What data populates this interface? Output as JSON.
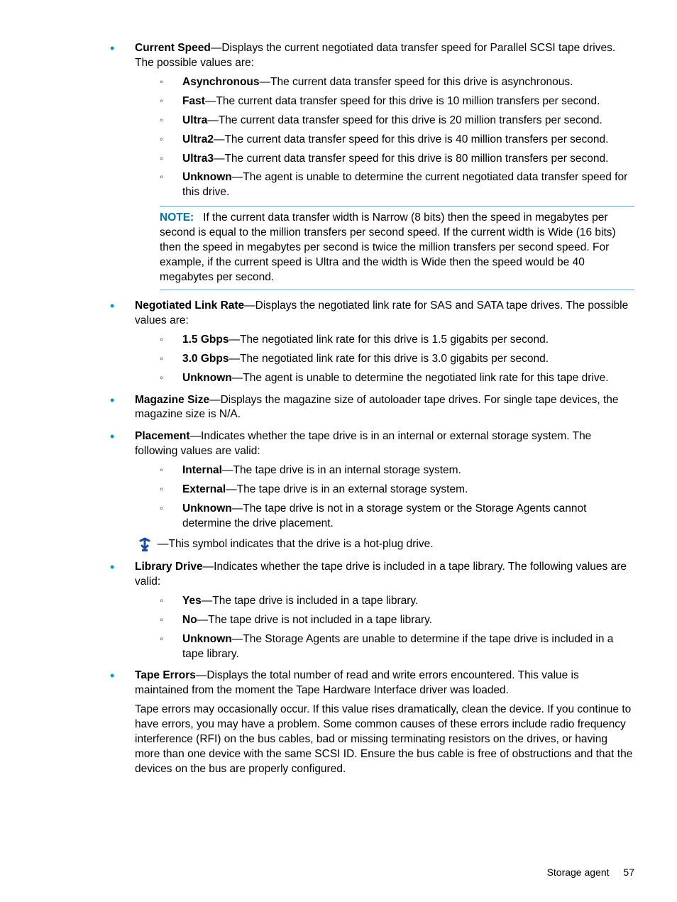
{
  "items": {
    "currentSpeed": {
      "term": "Current Speed",
      "desc": "—Displays the current negotiated data transfer speed for Parallel SCSI tape drives. The possible values are:",
      "sub": [
        {
          "term": "Asynchronous",
          "desc": "—The current data transfer speed for this drive is asynchronous."
        },
        {
          "term": "Fast",
          "desc": "—The current data transfer speed for this drive is 10 million transfers per second."
        },
        {
          "term": "Ultra",
          "desc": "—The current data transfer speed for this drive is 20 million transfers per second."
        },
        {
          "term": "Ultra2",
          "desc": "—The current data transfer speed for this drive is 40 million transfers per second."
        },
        {
          "term": "Ultra3",
          "desc": "—The current data transfer speed for this drive is 80 million transfers per second."
        },
        {
          "term": "Unknown",
          "desc": "—The agent is unable to determine the current negotiated data transfer speed for this drive."
        }
      ],
      "note": {
        "label": "NOTE:",
        "text": "If the current data transfer width is Narrow (8 bits) then the speed in megabytes per second is equal to the million transfers per second speed. If the current width is Wide (16 bits) then the speed in megabytes per second is twice the million transfers per second speed. For example, if the current speed is Ultra and the width is Wide then the speed would be 40 megabytes per second."
      }
    },
    "negLinkRate": {
      "term": "Negotiated Link Rate",
      "desc": "—Displays the negotiated link rate for SAS and SATA tape drives. The possible values are:",
      "sub": [
        {
          "term": "1.5 Gbps",
          "desc": "—The negotiated link rate for this drive is 1.5 gigabits per second."
        },
        {
          "term": "3.0 Gbps",
          "desc": "—The negotiated link rate for this drive is 3.0 gigabits per second."
        },
        {
          "term": "Unknown",
          "desc": "—The agent is unable to determine the negotiated link rate for this tape drive."
        }
      ]
    },
    "magSize": {
      "term": "Magazine Size",
      "desc": "—Displays the magazine size of autoloader tape drives. For single tape devices, the magazine size is N/A."
    },
    "placement": {
      "term": "Placement",
      "desc": "—Indicates whether the tape drive is in an internal or external storage system. The following values are valid:",
      "sub": [
        {
          "term": "Internal",
          "desc": "—The tape drive is in an internal storage system."
        },
        {
          "term": "External",
          "desc": "—The tape drive is in an external storage system."
        },
        {
          "term": "Unknown",
          "desc": "—The tape drive is not in a storage system or the Storage Agents cannot determine the drive placement."
        }
      ],
      "hotplug": "—This symbol indicates that the drive is a hot-plug drive."
    },
    "libDrive": {
      "term": "Library Drive",
      "desc": "—Indicates whether the tape drive is included in a tape library. The following values are valid:",
      "sub": [
        {
          "term": "Yes",
          "desc": "—The tape drive is included in a tape library."
        },
        {
          "term": "No",
          "desc": "—The tape drive is not included in a tape library."
        },
        {
          "term": "Unknown",
          "desc": "—The Storage Agents are unable to determine if the tape drive is included in a tape library."
        }
      ]
    },
    "tapeErrors": {
      "term": "Tape Errors",
      "desc": "—Displays the total number of read and write errors encountered. This value is maintained from the moment the Tape Hardware Interface driver was loaded.",
      "para": "Tape errors may occasionally occur. If this value rises dramatically, clean the device. If you continue to have errors, you may have a problem. Some common causes of these errors include radio frequency interference (RFI) on the bus cables, bad or missing terminating resistors on the drives, or having more than one device with the same SCSI ID. Ensure the bus cable is free of obstructions and that the devices on the bus are properly configured."
    }
  },
  "footer": {
    "section": "Storage agent",
    "page": "57"
  }
}
